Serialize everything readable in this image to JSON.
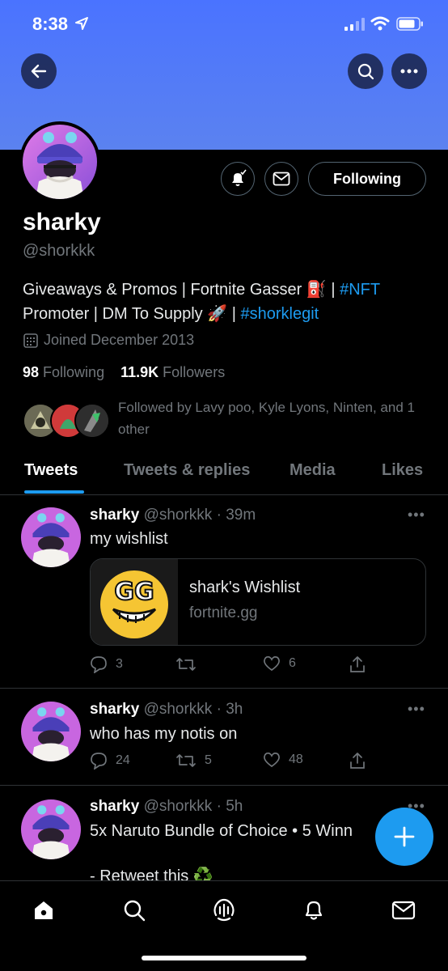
{
  "status_bar": {
    "time": "8:38"
  },
  "profile": {
    "name": "sharky",
    "handle": "@shorkkk",
    "bio_part1": "Giveaways & Promos | Fortnite Gasser ",
    "bio_emoji1": "⛽",
    "bio_sep": " | ",
    "bio_tag1": "#NFT",
    "bio_part2": "Promoter | DM To Supply ",
    "bio_emoji2": "🚀",
    "bio_tag2": "#shorklegit",
    "joined": "Joined December 2013",
    "following_count": "98",
    "following_label": "Following",
    "followers_count": "11.9K",
    "followers_label": "Followers",
    "followed_by": "Followed by Lavy poo, Kyle Lyons, Ninten, and 1 other",
    "follow_button": "Following"
  },
  "tabs": [
    "Tweets",
    "Tweets & replies",
    "Media",
    "Likes"
  ],
  "tweets": [
    {
      "name": "sharky",
      "meta": "@shorkkk · 39m",
      "text": "my wishlist",
      "card": {
        "title": "shark's Wishlist",
        "domain": "fortnite.gg",
        "logo_text": "GG"
      },
      "replies": "3",
      "retweets": "",
      "likes": "6"
    },
    {
      "name": "sharky",
      "meta": "@shorkkk · 3h",
      "text": "who has my notis on",
      "replies": "24",
      "retweets": "5",
      "likes": "48"
    },
    {
      "name": "sharky",
      "meta": "@shorkkk · 5h",
      "text": "5x Naruto Bundle of Choice • 5 Winn",
      "text2": "- Retweet this ♻️"
    }
  ],
  "more_glyph": "•••",
  "colors": {
    "accent": "#1d9bf0",
    "banner": "#4a73ff",
    "background": "#000000",
    "muted": "#71767b"
  }
}
